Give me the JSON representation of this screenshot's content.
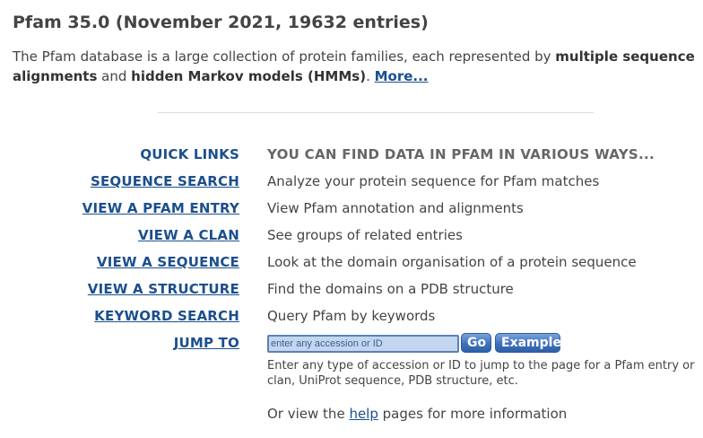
{
  "header": {
    "title": "Pfam 35.0 (November 2021, 19632 entries)"
  },
  "intro": {
    "text_1": "The Pfam database is a large collection of protein families, each represented by ",
    "bold_1": "multiple sequence alignments",
    "text_2": " and ",
    "bold_2": "hidden Markov models (HMMs)",
    "text_3": ". ",
    "more_link": "More..."
  },
  "quick_links": {
    "heading_label": "QUICK LINKS",
    "heading_desc": "YOU CAN FIND DATA IN PFAM IN VARIOUS WAYS...",
    "items": [
      {
        "label": "SEQUENCE SEARCH",
        "desc": "Analyze your protein sequence for Pfam matches"
      },
      {
        "label": "VIEW A PFAM ENTRY",
        "desc": "View Pfam annotation and alignments"
      },
      {
        "label": "VIEW A CLAN",
        "desc": "See groups of related entries"
      },
      {
        "label": "VIEW A SEQUENCE",
        "desc": "Look at the domain organisation of a protein sequence"
      },
      {
        "label": "VIEW A STRUCTURE",
        "desc": "Find the domains on a PDB structure"
      },
      {
        "label": "KEYWORD SEARCH",
        "desc": "Query Pfam by keywords"
      }
    ]
  },
  "jump": {
    "label": "JUMP TO",
    "placeholder": "enter any accession or ID",
    "value": "",
    "go_button": "Go",
    "example_button": "Example",
    "help": "Enter any type of accession or ID to jump to the page for a Pfam entry or clan, UniProt sequence, PDB structure, etc."
  },
  "help_line": {
    "prefix": "Or view the ",
    "link": "help",
    "suffix": " pages for more information"
  },
  "colors": {
    "link": "#1b4f8d",
    "text": "#444444",
    "heading_gray": "#666666",
    "button_blue": "#3f71bd",
    "input_fill": "#c4d6ee"
  }
}
